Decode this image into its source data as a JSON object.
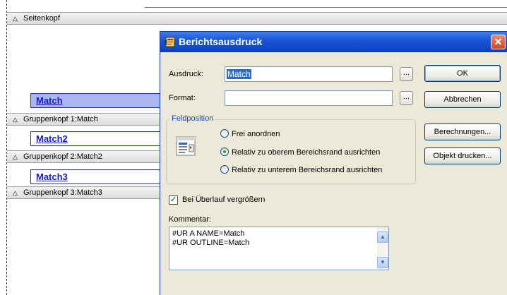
{
  "designer": {
    "bands": [
      {
        "label": "Seitenkopf"
      },
      {
        "label": "Gruppenkopf 1:Match"
      },
      {
        "label": "Gruppenkopf 2:Match2"
      },
      {
        "label": "Gruppenkopf 3:Match3"
      }
    ],
    "fields": [
      "Match",
      "Match2",
      "Match3"
    ]
  },
  "dialog": {
    "title": "Berichtsausdruck",
    "close_glyph": "✕",
    "ausdruck_label": "Ausdruck:",
    "ausdruck_value": "Match",
    "format_label": "Format:",
    "format_value": "",
    "browse_label": "...",
    "ok_label": "OK",
    "cancel_label": "Abbrechen",
    "calc_label": "Berechnungen...",
    "print_object_label": "Objekt drucken...",
    "feldposition": {
      "title": "Feldposition",
      "options": [
        {
          "label": "Frei anordnen",
          "checked": false
        },
        {
          "label": "Relativ zu oberem Bereichsrand ausrichten",
          "checked": true
        },
        {
          "label": "Relativ zu unterem Bereichsrand ausrichten",
          "checked": false
        }
      ]
    },
    "overflow_label": "Bei Überlauf vergrößern",
    "overflow_checked": true,
    "kommentar_label": "Kommentar:",
    "kommentar_lines": [
      "#UR A NAME=Match",
      "#UR OUTLINE=Match"
    ],
    "scroll_up": "▲",
    "scroll_down": "▼"
  },
  "colors": {
    "titlebar": "#0b44c6",
    "dialog_bg": "#ece9d8",
    "field_text": "#1a1ac8",
    "group_title": "#0046d5"
  }
}
